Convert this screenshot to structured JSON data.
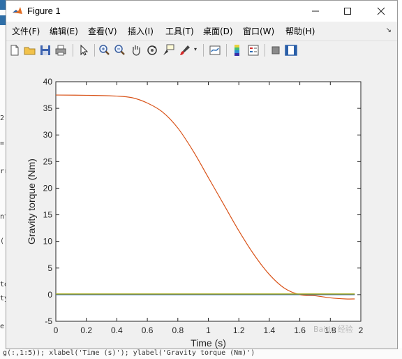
{
  "window": {
    "title": "Figure 1"
  },
  "menu": {
    "items": [
      "文件(F)",
      "编辑(E)",
      "查看(V)",
      "插入(I)",
      "工具(T)",
      "桌面(D)",
      "窗口(W)",
      "帮助(H)"
    ]
  },
  "toolbar": {
    "icons": [
      "new-figure-icon",
      "open-file-icon",
      "save-icon",
      "print-icon",
      "pointer-icon",
      "zoom-in-icon",
      "zoom-out-icon",
      "pan-icon",
      "rotate-3d-icon",
      "data-cursor-icon",
      "brush-icon",
      "link-plot-icon",
      "colorbar-icon",
      "legend-icon",
      "hide-plot-tools-icon",
      "show-plot-tools-icon"
    ]
  },
  "background": {
    "command_line": "g(:,1:5)); xlabel('Time (s)'); ylabel('Gravity torque (Nm)')",
    "editor_fragments": [
      "2",
      "=",
      "rr",
      "nt",
      "(:",
      "to",
      "ty",
      "e"
    ]
  },
  "watermark": "Baidu 经验",
  "chart_data": {
    "type": "line",
    "xlabel": "Time (s)",
    "ylabel": "Gravity torque (Nm)",
    "xlim": [
      0,
      2
    ],
    "ylim": [
      -5,
      40
    ],
    "xticks": [
      0,
      0.2,
      0.4,
      0.6,
      0.8,
      1,
      1.2,
      1.4,
      1.6,
      1.8,
      2
    ],
    "xtick_labels": [
      "0",
      "0.2",
      "0.4",
      "0.6",
      "0.8",
      "1",
      "1.2",
      "1.4",
      "1.6",
      "1.8",
      "2"
    ],
    "yticks": [
      -5,
      0,
      5,
      10,
      15,
      20,
      25,
      30,
      35,
      40
    ],
    "ytick_labels": [
      "-5",
      "0",
      "5",
      "10",
      "15",
      "20",
      "25",
      "30",
      "35",
      "40"
    ],
    "grid": false,
    "series": [
      {
        "color": "#0072bd",
        "x": [
          0,
          1.96
        ],
        "y": [
          0,
          0
        ]
      },
      {
        "color": "#d95319",
        "x": [
          0,
          0.2,
          0.4,
          0.5,
          0.6,
          0.7,
          0.8,
          0.9,
          1.0,
          1.1,
          1.2,
          1.3,
          1.4,
          1.5,
          1.6,
          1.7,
          1.8,
          1.9,
          1.96
        ],
        "y": [
          37.5,
          37.45,
          37.3,
          37.0,
          36.0,
          34.3,
          31.3,
          27.0,
          22.0,
          17.0,
          12.0,
          7.5,
          3.8,
          1.2,
          0.0,
          -0.2,
          -0.6,
          -0.8,
          -0.8
        ]
      },
      {
        "color": "#edb120",
        "x": [
          0,
          1.96
        ],
        "y": [
          0.15,
          0.15
        ]
      },
      {
        "color": "#7e2f8e",
        "x": [
          0,
          1.96
        ],
        "y": [
          0.05,
          0.05
        ]
      },
      {
        "color": "#77ac30",
        "x": [
          0,
          1.96
        ],
        "y": [
          0.1,
          0.1
        ]
      }
    ]
  }
}
